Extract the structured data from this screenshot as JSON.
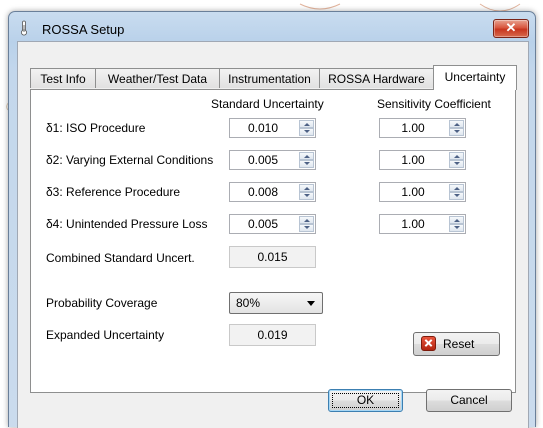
{
  "window": {
    "title": "ROSSA Setup",
    "close_glyph": "✕"
  },
  "tabs": [
    {
      "label": "Test Info"
    },
    {
      "label": "Weather/Test Data"
    },
    {
      "label": "Instrumentation"
    },
    {
      "label": "ROSSA Hardware"
    },
    {
      "label": "Uncertainty",
      "active": true
    }
  ],
  "headers": {
    "standard_uncertainty": "Standard Uncertainty",
    "sensitivity_coefficient": "Sensitivity Coefficient"
  },
  "rows": [
    {
      "label": "δ1: ISO Procedure",
      "std": "0.010",
      "sens": "1.00"
    },
    {
      "label": "δ2: Varying External Conditions",
      "std": "0.005",
      "sens": "1.00"
    },
    {
      "label": "δ3: Reference Procedure",
      "std": "0.008",
      "sens": "1.00"
    },
    {
      "label": "δ4: Unintended Pressure Loss",
      "std": "0.005",
      "sens": "1.00"
    }
  ],
  "combined": {
    "label": "Combined Standard Uncert.",
    "value": "0.015"
  },
  "coverage": {
    "label": "Probability Coverage",
    "value": "80%"
  },
  "expanded": {
    "label": "Expanded Uncertainty",
    "value": "0.019"
  },
  "buttons": {
    "reset": "Reset",
    "ok": "OK",
    "cancel": "Cancel"
  },
  "icons": {
    "app": "thermometer-icon",
    "close": "close-icon",
    "reset": "reset-x-icon"
  },
  "colors": {
    "close_button": "#c7351f",
    "titlebar": "#b9d1ea"
  }
}
